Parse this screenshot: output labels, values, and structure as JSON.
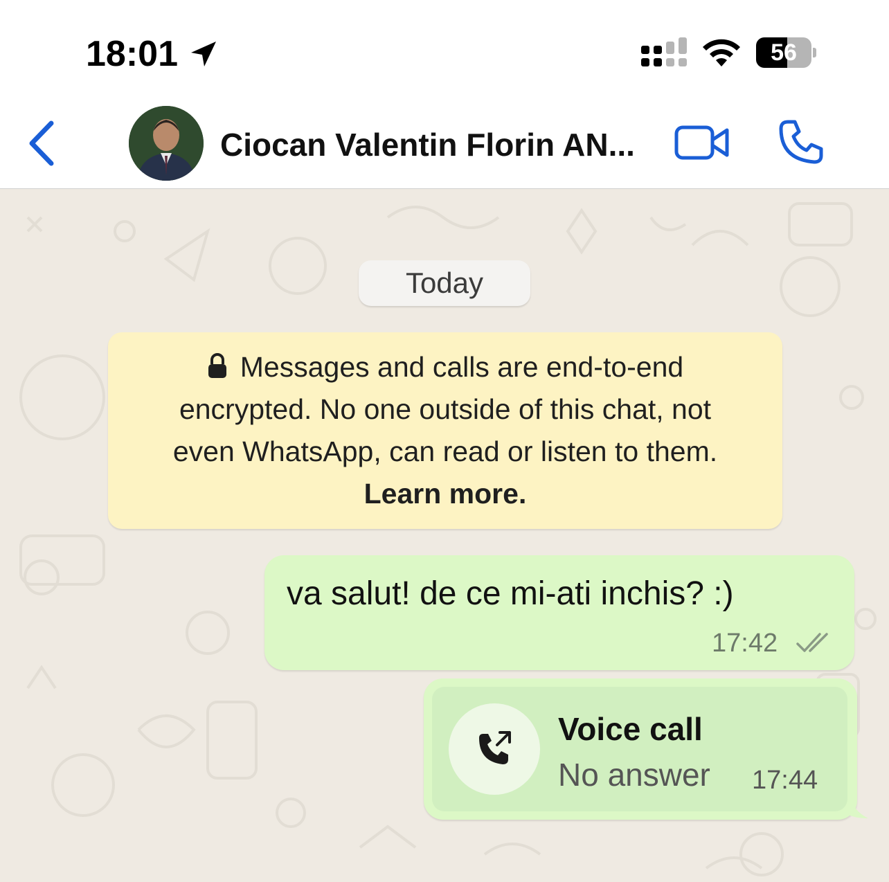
{
  "status_bar": {
    "time": "18:01",
    "battery": "56",
    "battery_level": 0.56,
    "icons": [
      "location-arrow-icon",
      "cellular-signal-icon",
      "wifi-icon",
      "battery-icon"
    ]
  },
  "header": {
    "contact_name": "Ciocan Valentin Florin AN...",
    "icons": [
      "chevron-left-icon",
      "video-camera-icon",
      "phone-icon"
    ],
    "accent_color": "#1a5ed6"
  },
  "chat": {
    "date_chip": "Today",
    "encryption_notice": {
      "line1": "Messages and calls are end-to-end",
      "line2": "encrypted. No one outside of this chat, not",
      "line3": "even WhatsApp, can read or listen to them.",
      "learn_more": "Learn more."
    },
    "messages": [
      {
        "direction": "outgoing",
        "text": "va salut! de ce mi-ati inchis? :)",
        "time": "17:42",
        "status_icon": "double-check-icon"
      }
    ],
    "call": {
      "title": "Voice call",
      "status": "No answer",
      "time": "17:44",
      "icon": "outgoing-call-icon"
    },
    "colors": {
      "background": "#efeae2",
      "outgoing_bubble": "#dcf8c6",
      "notice_bubble": "#fdf3c3"
    }
  }
}
